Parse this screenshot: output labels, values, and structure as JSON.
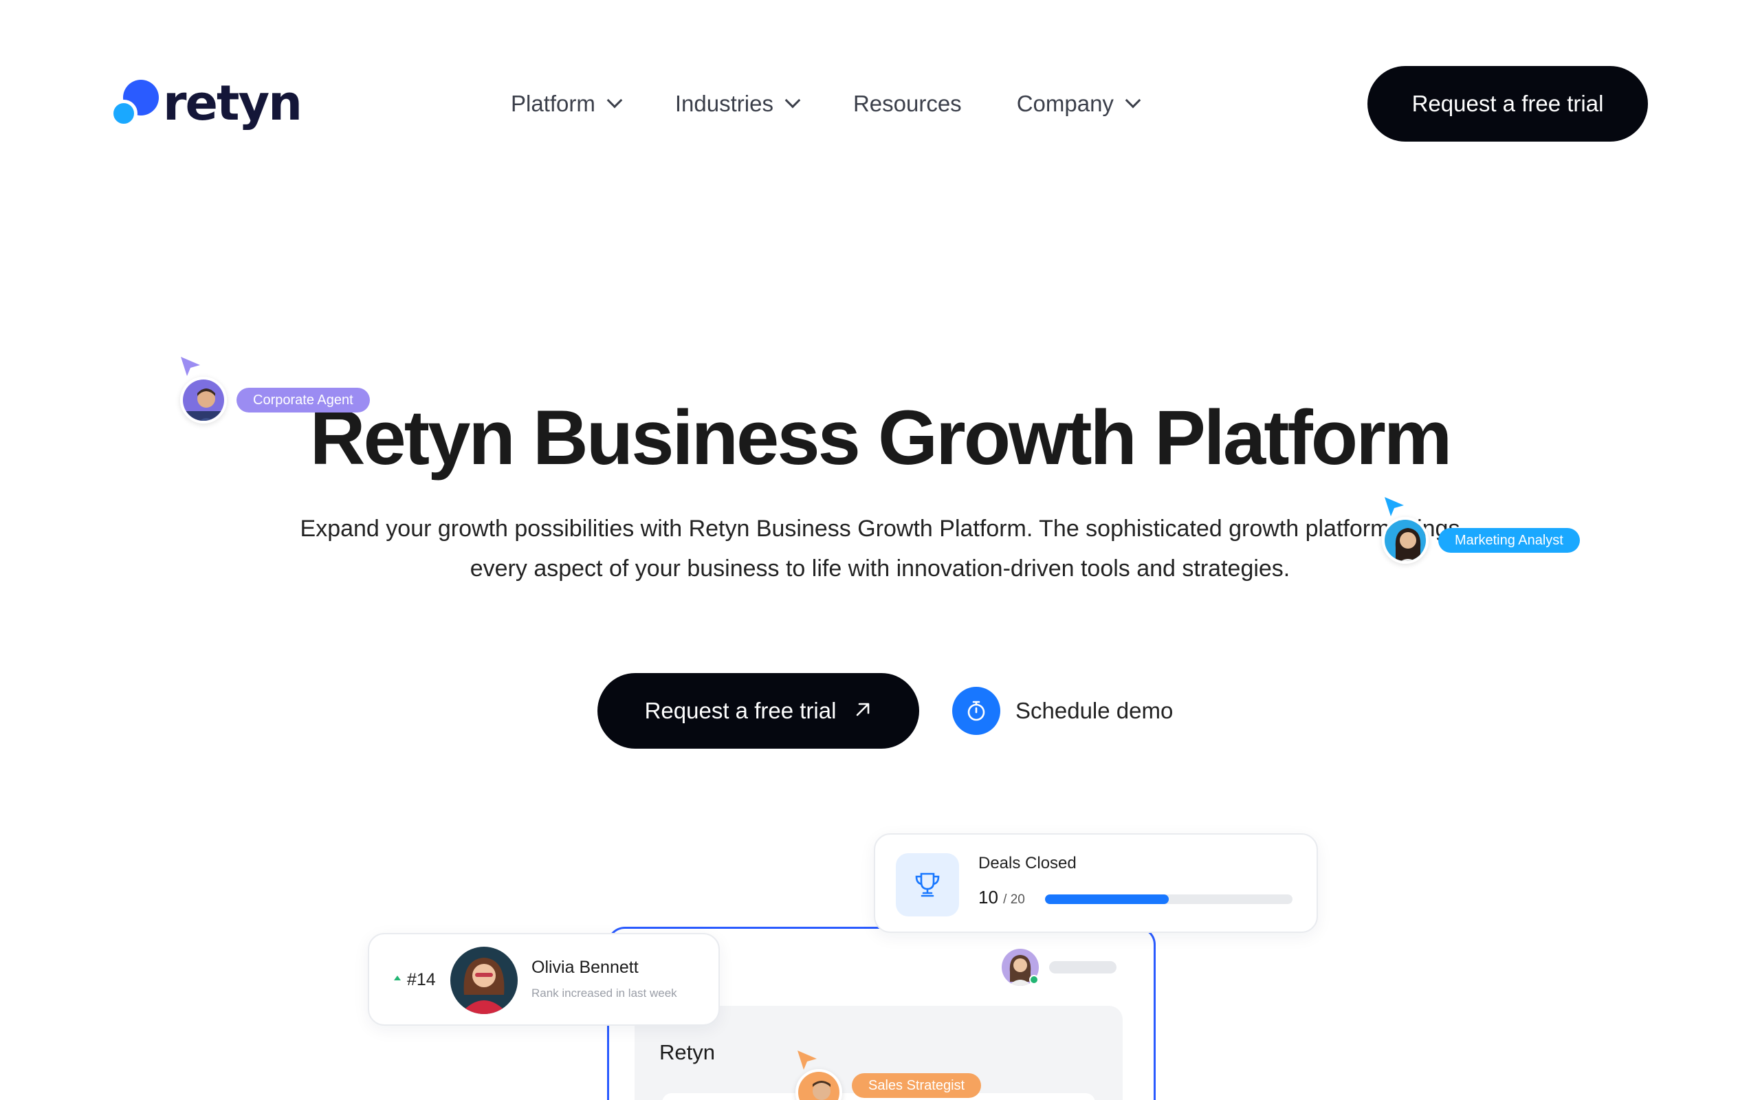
{
  "brand": {
    "name": "retyn",
    "primary_color": "#2a5bff",
    "secondary_color": "#1aa8ff"
  },
  "nav": {
    "items": [
      {
        "label": "Platform",
        "has_dropdown": true
      },
      {
        "label": "Industries",
        "has_dropdown": true
      },
      {
        "label": "Resources",
        "has_dropdown": false
      },
      {
        "label": "Company",
        "has_dropdown": true
      }
    ],
    "cta_label": "Request a free trial"
  },
  "hero": {
    "title": "Retyn Business Growth Platform",
    "subtitle_line1": "Expand your growth possibilities with Retyn Business Growth Platform. The sophisticated growth platform brings",
    "subtitle_line2": "every aspect of your business to life with innovation-driven tools and strategies.",
    "primary_cta": "Request a free trial",
    "primary_cta_icon": "arrow-up-right-icon",
    "secondary_cta": "Schedule demo",
    "secondary_cta_icon": "stopwatch-icon"
  },
  "cursors": [
    {
      "label": "Corporate Agent",
      "color": "#9b8cf2"
    },
    {
      "label": "Marketing Analyst",
      "color": "#1aa8ff"
    },
    {
      "label": "Sales Strategist",
      "color": "#f6a35e"
    }
  ],
  "preview": {
    "deals": {
      "title": "Deals Closed",
      "value": "10",
      "total": "/ 20",
      "progress": 0.5,
      "icon": "trophy-icon",
      "bar_color": "#1877ff"
    },
    "rank": {
      "position": "#14",
      "name": "Olivia Bennett",
      "caption": "Rank increased in last week",
      "trend": "up"
    },
    "panel": {
      "title": "Retyn"
    }
  }
}
